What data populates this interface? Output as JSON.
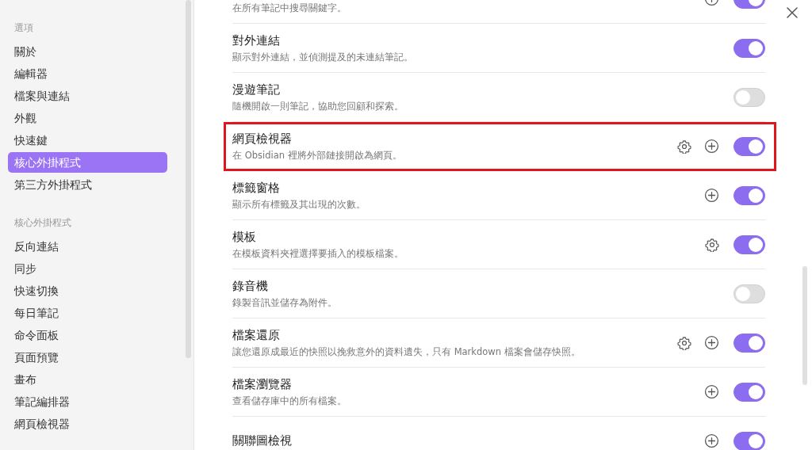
{
  "sidebar": {
    "sections": [
      {
        "heading": "選項",
        "items": [
          {
            "label": "關於",
            "selected": false
          },
          {
            "label": "編輯器",
            "selected": false
          },
          {
            "label": "檔案與連結",
            "selected": false
          },
          {
            "label": "外觀",
            "selected": false
          },
          {
            "label": "快速鍵",
            "selected": false
          },
          {
            "label": "核心外掛程式",
            "selected": true
          },
          {
            "label": "第三方外掛程式",
            "selected": false
          }
        ]
      },
      {
        "heading": "核心外掛程式",
        "items": [
          {
            "label": "反向連結",
            "selected": false
          },
          {
            "label": "同步",
            "selected": false
          },
          {
            "label": "快速切換",
            "selected": false
          },
          {
            "label": "每日筆記",
            "selected": false
          },
          {
            "label": "命令面板",
            "selected": false
          },
          {
            "label": "頁面預覽",
            "selected": false
          },
          {
            "label": "畫布",
            "selected": false
          },
          {
            "label": "筆記編排器",
            "selected": false
          },
          {
            "label": "網頁檢視器",
            "selected": false
          }
        ]
      }
    ]
  },
  "plugins": [
    {
      "description": "在所有筆記中搜尋關鍵字。",
      "has_settings": false,
      "has_hotkeys": true,
      "enabled": true,
      "highlighted": false
    },
    {
      "title": "對外連結",
      "description": "顯示對外連結，並偵測提及的未連結筆記。",
      "has_settings": false,
      "has_hotkeys": false,
      "enabled": true,
      "highlighted": false
    },
    {
      "title": "漫遊筆記",
      "description": "隨機開啟一則筆記，協助您回顧和探索。",
      "has_settings": false,
      "has_hotkeys": false,
      "enabled": false,
      "highlighted": false
    },
    {
      "title": "網頁檢視器",
      "description": "在 Obsidian 裡將外部鏈接開啟為網頁。",
      "has_settings": true,
      "has_hotkeys": true,
      "enabled": true,
      "highlighted": true
    },
    {
      "title": "標籤窗格",
      "description": "顯示所有標籤及其出現的次數。",
      "has_settings": false,
      "has_hotkeys": true,
      "enabled": true,
      "highlighted": false
    },
    {
      "title": "模板",
      "description": "在模板資料夾裡選擇要插入的模板檔案。",
      "has_settings": true,
      "has_hotkeys": false,
      "enabled": true,
      "highlighted": false
    },
    {
      "title": "錄音機",
      "description": "錄製音訊並儲存為附件。",
      "has_settings": false,
      "has_hotkeys": false,
      "enabled": false,
      "highlighted": false
    },
    {
      "title": "檔案還原",
      "description": "讓您還原成最近的快照以挽救意外的資料遺失，只有 Markdown 檔案會儲存快照。",
      "has_settings": true,
      "has_hotkeys": true,
      "enabled": true,
      "highlighted": false
    },
    {
      "title": "檔案瀏覽器",
      "description": "查看儲存庫中的所有檔案。",
      "has_settings": false,
      "has_hotkeys": true,
      "enabled": true,
      "highlighted": false
    },
    {
      "title": "關聯圖檢視",
      "has_settings": false,
      "has_hotkeys": true,
      "enabled": true,
      "highlighted": false
    }
  ]
}
